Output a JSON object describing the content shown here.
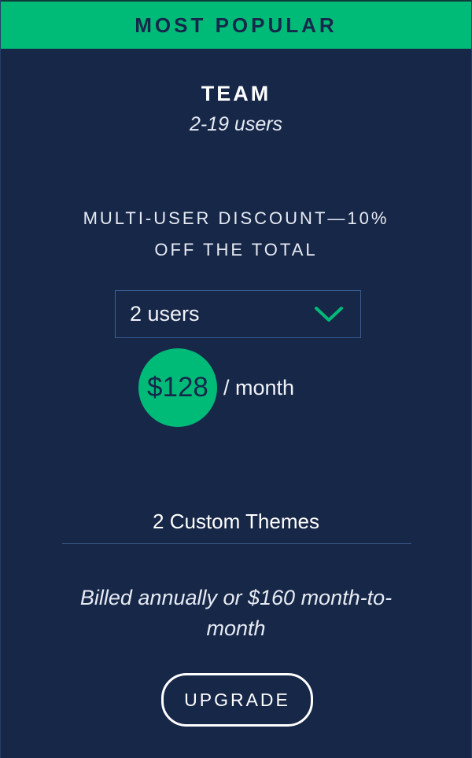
{
  "banner": {
    "label": "MOST POPULAR"
  },
  "plan": {
    "name": "TEAM",
    "users_range": "2-19 users",
    "discount_line1": "MULTI-USER DISCOUNT—10%",
    "discount_line2": "OFF THE TOTAL"
  },
  "users_select": {
    "selected": "2 users",
    "icon": "chevron-down-icon"
  },
  "price": {
    "amount": "$128",
    "period": "/ month"
  },
  "features": {
    "themes": "2 Custom Themes"
  },
  "billing": {
    "note": "Billed annually or $160 month-to-month"
  },
  "cta": {
    "label": "UPGRADE"
  },
  "colors": {
    "background": "#172748",
    "accent": "#00ba78",
    "dark_text": "#15284a",
    "border": "#3a5d92"
  }
}
